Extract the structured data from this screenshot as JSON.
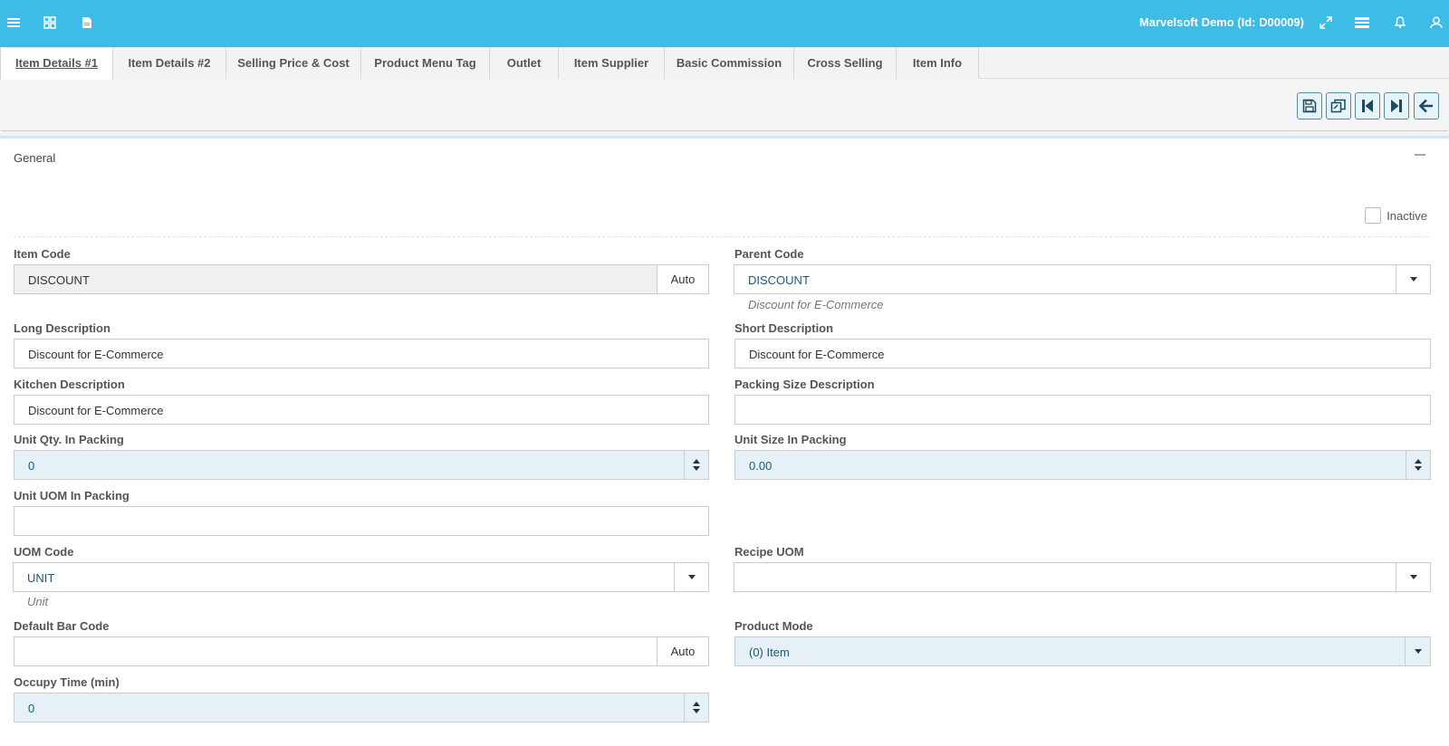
{
  "header": {
    "company": "Marvelsoft Demo (Id: D00009)",
    "left_icons": [
      "menu-icon",
      "grid-icon",
      "document-icon"
    ],
    "right_icons": [
      "expand-icon",
      "settings-icon",
      "bell-icon",
      "user-icon"
    ]
  },
  "tabs": [
    {
      "label": "Item Details #1",
      "active": true
    },
    {
      "label": "Item Details #2"
    },
    {
      "label": "Selling Price & Cost"
    },
    {
      "label": "Product Menu Tag"
    },
    {
      "label": "Outlet"
    },
    {
      "label": "Item Supplier"
    },
    {
      "label": "Basic Commission"
    },
    {
      "label": "Cross Selling"
    },
    {
      "label": "Item Info"
    }
  ],
  "toolbar": {
    "buttons": [
      "save-icon",
      "copy-icon",
      "first-record-icon",
      "last-record-icon",
      "back-arrow-icon"
    ]
  },
  "panel": {
    "title": "General",
    "inactive_label": "Inactive"
  },
  "form": {
    "item_code": {
      "label": "Item Code",
      "value": "DISCOUNT",
      "addon": "Auto"
    },
    "parent_code": {
      "label": "Parent Code",
      "value": "DISCOUNT",
      "hint": "Discount for E-Commerce"
    },
    "long_description": {
      "label": "Long Description",
      "value": "Discount for E-Commerce"
    },
    "short_description": {
      "label": "Short Description",
      "value": "Discount for E-Commerce"
    },
    "kitchen_description": {
      "label": "Kitchen Description",
      "value": "Discount for E-Commerce"
    },
    "packing_size_description": {
      "label": "Packing Size Description",
      "value": ""
    },
    "unit_qty_in_packing": {
      "label": "Unit Qty. In Packing",
      "value": "0"
    },
    "unit_size_in_packing": {
      "label": "Unit Size In Packing",
      "value": "0.00"
    },
    "unit_uom_in_packing": {
      "label": "Unit UOM In Packing",
      "value": ""
    },
    "uom_code": {
      "label": "UOM Code",
      "value": "UNIT",
      "hint": "Unit"
    },
    "recipe_uom": {
      "label": "Recipe UOM",
      "value": ""
    },
    "default_bar_code": {
      "label": "Default Bar Code",
      "value": "",
      "addon": "Auto"
    },
    "product_mode": {
      "label": "Product Mode",
      "value": "(0) Item"
    },
    "occupy_time": {
      "label": "Occupy Time (min)",
      "value": "0"
    }
  }
}
